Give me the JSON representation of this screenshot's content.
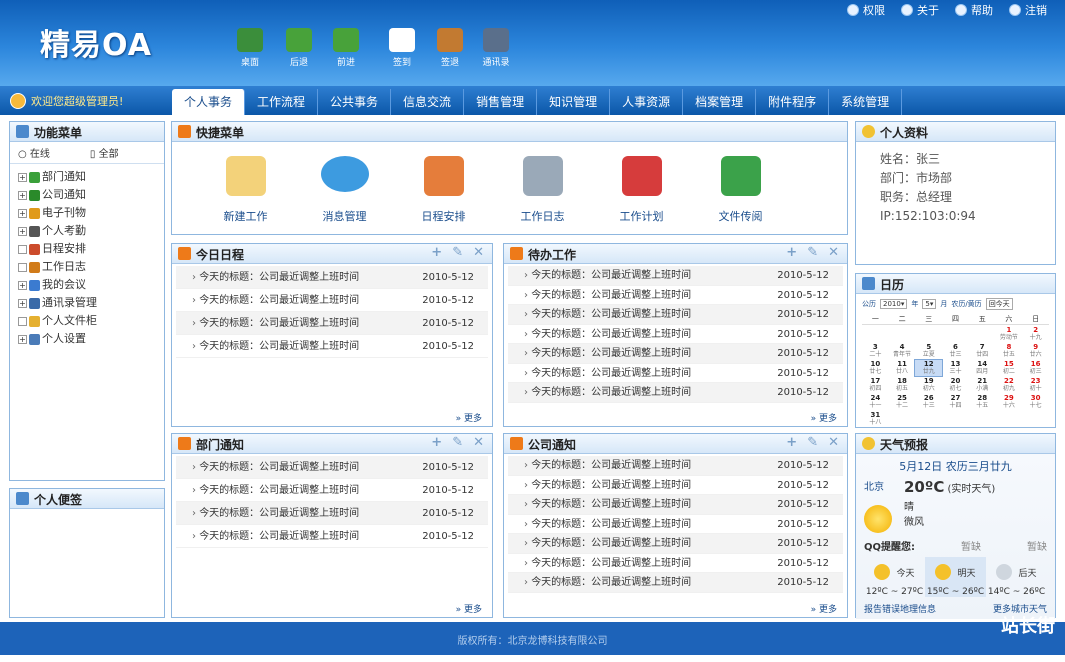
{
  "app": {
    "logo": "精易OA"
  },
  "toolbar": [
    {
      "label": "桌面",
      "icon": "home-icon",
      "color": "#3b8e3b"
    },
    {
      "label": "后退",
      "icon": "arrow-left-icon",
      "color": "#48a23a"
    },
    {
      "label": "前进",
      "icon": "arrow-right-icon",
      "color": "#48a23a"
    },
    {
      "label": "签到",
      "icon": "checkin-icon",
      "color": "#ffffff"
    },
    {
      "label": "签退",
      "icon": "briefcase-icon",
      "color": "#c27a31"
    },
    {
      "label": "通讯录",
      "icon": "address-book-icon",
      "color": "#5a6f8b"
    }
  ],
  "topright": [
    "权限",
    "关于",
    "帮助",
    "注销"
  ],
  "welcome": "欢迎您超级管理员!",
  "tabs": [
    "个人事务",
    "工作流程",
    "公共事务",
    "信息交流",
    "销售管理",
    "知识管理",
    "人事资源",
    "档案管理",
    "附件程序",
    "系统管理"
  ],
  "menu": {
    "title": "功能菜单",
    "filter_online": "在线",
    "filter_all": "全部",
    "items": [
      {
        "label": "部门通知",
        "icon": "speaker-icon",
        "color": "#3aa03a",
        "plus": true
      },
      {
        "label": "公司通知",
        "icon": "star-icon",
        "color": "#2a8a2a",
        "plus": true
      },
      {
        "label": "电子刊物",
        "icon": "book-icon",
        "color": "#e09a1a",
        "plus": true
      },
      {
        "label": "个人考勤",
        "icon": "clock-icon",
        "color": "#555555",
        "plus": true
      },
      {
        "label": "日程安排",
        "icon": "calendar-icon",
        "color": "#cc4b2b",
        "plus": false
      },
      {
        "label": "工作日志",
        "icon": "pencil-icon",
        "color": "#d17b19",
        "plus": false
      },
      {
        "label": "我的会议",
        "icon": "people-icon",
        "color": "#3b7bd0",
        "plus": true
      },
      {
        "label": "通讯录管理",
        "icon": "contacts-icon",
        "color": "#3a6aa8",
        "plus": true
      },
      {
        "label": "个人文件柜",
        "icon": "folder-icon",
        "color": "#e5b030",
        "plus": false
      },
      {
        "label": "个人设置",
        "icon": "settings-icon",
        "color": "#4a7bb8",
        "plus": true
      }
    ]
  },
  "notes": {
    "title": "个人便签"
  },
  "quick": {
    "title": "快捷菜单",
    "items": [
      {
        "label": "新建工作",
        "icon": "new-work-icon",
        "color": "#f3d27a"
      },
      {
        "label": "消息管理",
        "icon": "speech-bubble-icon",
        "color": "#3d9be0"
      },
      {
        "label": "日程安排",
        "icon": "calendar-icon",
        "color": "#e57d3b"
      },
      {
        "label": "工作日志",
        "icon": "document-icon",
        "color": "#9aa9b8"
      },
      {
        "label": "工作计划",
        "icon": "plan-icon",
        "color": "#d63c3c"
      },
      {
        "label": "文件传阅",
        "icon": "mail-icon",
        "color": "#3ba24a"
      }
    ]
  },
  "today": {
    "title": "今日日程",
    "more": "更多",
    "rows": [
      {
        "t": "今天的标题：公司最近调整上班时间",
        "d": "2010-5-12"
      },
      {
        "t": "今天的标题：公司最近调整上班时间",
        "d": "2010-5-12"
      },
      {
        "t": "今天的标题：公司最近调整上班时间",
        "d": "2010-5-12"
      },
      {
        "t": "今天的标题：公司最近调整上班时间",
        "d": "2010-5-12"
      }
    ]
  },
  "todo": {
    "title": "待办工作",
    "more": "更多",
    "rows": [
      {
        "t": "今天的标题：公司最近调整上班时间",
        "d": "2010-5-12"
      },
      {
        "t": "今天的标题：公司最近调整上班时间",
        "d": "2010-5-12"
      },
      {
        "t": "今天的标题：公司最近调整上班时间",
        "d": "2010-5-12"
      },
      {
        "t": "今天的标题：公司最近调整上班时间",
        "d": "2010-5-12"
      },
      {
        "t": "今天的标题：公司最近调整上班时间",
        "d": "2010-5-12"
      },
      {
        "t": "今天的标题：公司最近调整上班时间",
        "d": "2010-5-12"
      },
      {
        "t": "今天的标题：公司最近调整上班时间",
        "d": "2010-5-12"
      }
    ]
  },
  "dept": {
    "title": "部门通知",
    "more": "更多",
    "rows": [
      {
        "t": "今天的标题：公司最近调整上班时间",
        "d": "2010-5-12"
      },
      {
        "t": "今天的标题：公司最近调整上班时间",
        "d": "2010-5-12"
      },
      {
        "t": "今天的标题：公司最近调整上班时间",
        "d": "2010-5-12"
      },
      {
        "t": "今天的标题：公司最近调整上班时间",
        "d": "2010-5-12"
      }
    ]
  },
  "company": {
    "title": "公司通知",
    "more": "更多",
    "rows": [
      {
        "t": "今天的标题：公司最近调整上班时间",
        "d": "2010-5-12"
      },
      {
        "t": "今天的标题：公司最近调整上班时间",
        "d": "2010-5-12"
      },
      {
        "t": "今天的标题：公司最近调整上班时间",
        "d": "2010-5-12"
      },
      {
        "t": "今天的标题：公司最近调整上班时间",
        "d": "2010-5-12"
      },
      {
        "t": "今天的标题：公司最近调整上班时间",
        "d": "2010-5-12"
      },
      {
        "t": "今天的标题：公司最近调整上班时间",
        "d": "2010-5-12"
      },
      {
        "t": "今天的标题：公司最近调整上班时间",
        "d": "2010-5-12"
      }
    ]
  },
  "profile": {
    "title": "个人资料",
    "lines": [
      "姓名：张三",
      "部门：市场部",
      "职务：总经理",
      "IP:152:103:0:94"
    ]
  },
  "calendar": {
    "title": "日历",
    "label": "公历",
    "year": "2010",
    "year_unit": "年",
    "month": "5",
    "month_unit": "月",
    "legend": "农历/黄历",
    "goto_label": "回今天",
    "weekdays": [
      "一",
      "二",
      "三",
      "四",
      "五",
      "六",
      "日"
    ],
    "days": [
      {
        "d": "",
        "l": ""
      },
      {
        "d": "",
        "l": ""
      },
      {
        "d": "",
        "l": ""
      },
      {
        "d": "",
        "l": ""
      },
      {
        "d": "",
        "l": ""
      },
      {
        "d": "1",
        "l": "劳动节",
        "red": true
      },
      {
        "d": "2",
        "l": "十九",
        "red": true
      },
      {
        "d": "3",
        "l": "二十"
      },
      {
        "d": "4",
        "l": "青年节"
      },
      {
        "d": "5",
        "l": "立夏"
      },
      {
        "d": "6",
        "l": "廿三"
      },
      {
        "d": "7",
        "l": "廿四"
      },
      {
        "d": "8",
        "l": "廿五",
        "red": true
      },
      {
        "d": "9",
        "l": "廿六",
        "red": true
      },
      {
        "d": "10",
        "l": "廿七"
      },
      {
        "d": "11",
        "l": "廿八"
      },
      {
        "d": "12",
        "l": "廿九",
        "today": true
      },
      {
        "d": "13",
        "l": "三十"
      },
      {
        "d": "14",
        "l": "四月"
      },
      {
        "d": "15",
        "l": "初二",
        "red": true
      },
      {
        "d": "16",
        "l": "初三",
        "red": true
      },
      {
        "d": "17",
        "l": "初四"
      },
      {
        "d": "18",
        "l": "初五"
      },
      {
        "d": "19",
        "l": "初六"
      },
      {
        "d": "20",
        "l": "初七"
      },
      {
        "d": "21",
        "l": "小满"
      },
      {
        "d": "22",
        "l": "初九",
        "red": true
      },
      {
        "d": "23",
        "l": "初十",
        "red": true
      },
      {
        "d": "24",
        "l": "十一"
      },
      {
        "d": "25",
        "l": "十二"
      },
      {
        "d": "26",
        "l": "十三"
      },
      {
        "d": "27",
        "l": "十四"
      },
      {
        "d": "28",
        "l": "十五"
      },
      {
        "d": "29",
        "l": "十六",
        "red": true
      },
      {
        "d": "30",
        "l": "十七",
        "red": true
      },
      {
        "d": "31",
        "l": "十八"
      }
    ]
  },
  "weather": {
    "title": "天气预报",
    "date": "5月12日  农历三月廿九",
    "city": "北京",
    "temp": "20ºC",
    "realtime": "(实时天气)",
    "cond": "晴",
    "wind": "微风",
    "qq_label": "QQ提醒您:",
    "qq_a": "暂缺",
    "qq_b": "暂缺",
    "forecast": [
      {
        "day": "今天",
        "range": "12ºC ~ 27ºC"
      },
      {
        "day": "明天",
        "range": "15ºC ~ 26ºC"
      },
      {
        "day": "后天",
        "range": "14ºC ~ 26ºC"
      }
    ],
    "link_report": "报告错误地理信息",
    "link_more": "更多城市天气"
  },
  "footer": "版权所有：北京龙博科技有限公司",
  "watermark": "站长街"
}
